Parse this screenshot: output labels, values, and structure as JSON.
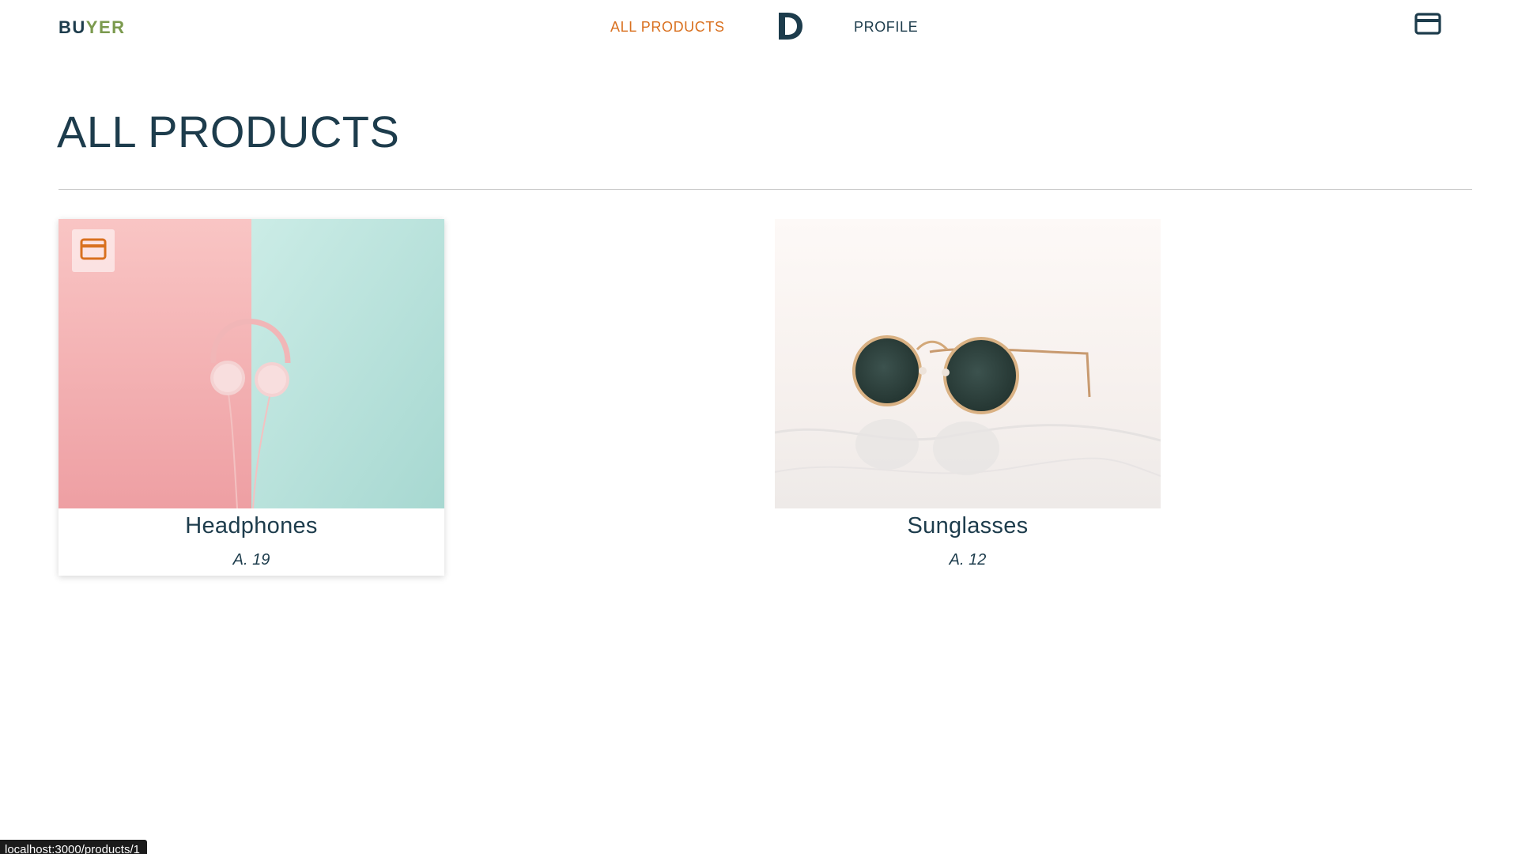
{
  "header": {
    "brand_part1": "BU",
    "brand_part2": "YER",
    "nav_all_products": "ALL PRODUCTS",
    "nav_profile": "PROFILE",
    "logo_icon": "d-logo-icon",
    "cart_icon": "credit-card-icon"
  },
  "main": {
    "title": "ALL PRODUCTS"
  },
  "products": [
    {
      "name": "Headphones",
      "price": "A. 19",
      "image": "pink-headphones-photo",
      "badge_icon": "credit-card-icon"
    },
    {
      "name": "Sunglasses",
      "price": "A. 12",
      "image": "sunglasses-photo"
    }
  ],
  "status_bar": {
    "url": "localhost:3000/products/1"
  },
  "colors": {
    "primary": "#1d3c4c",
    "accent": "#d9701f",
    "brand_secondary": "#7b9a4e"
  }
}
